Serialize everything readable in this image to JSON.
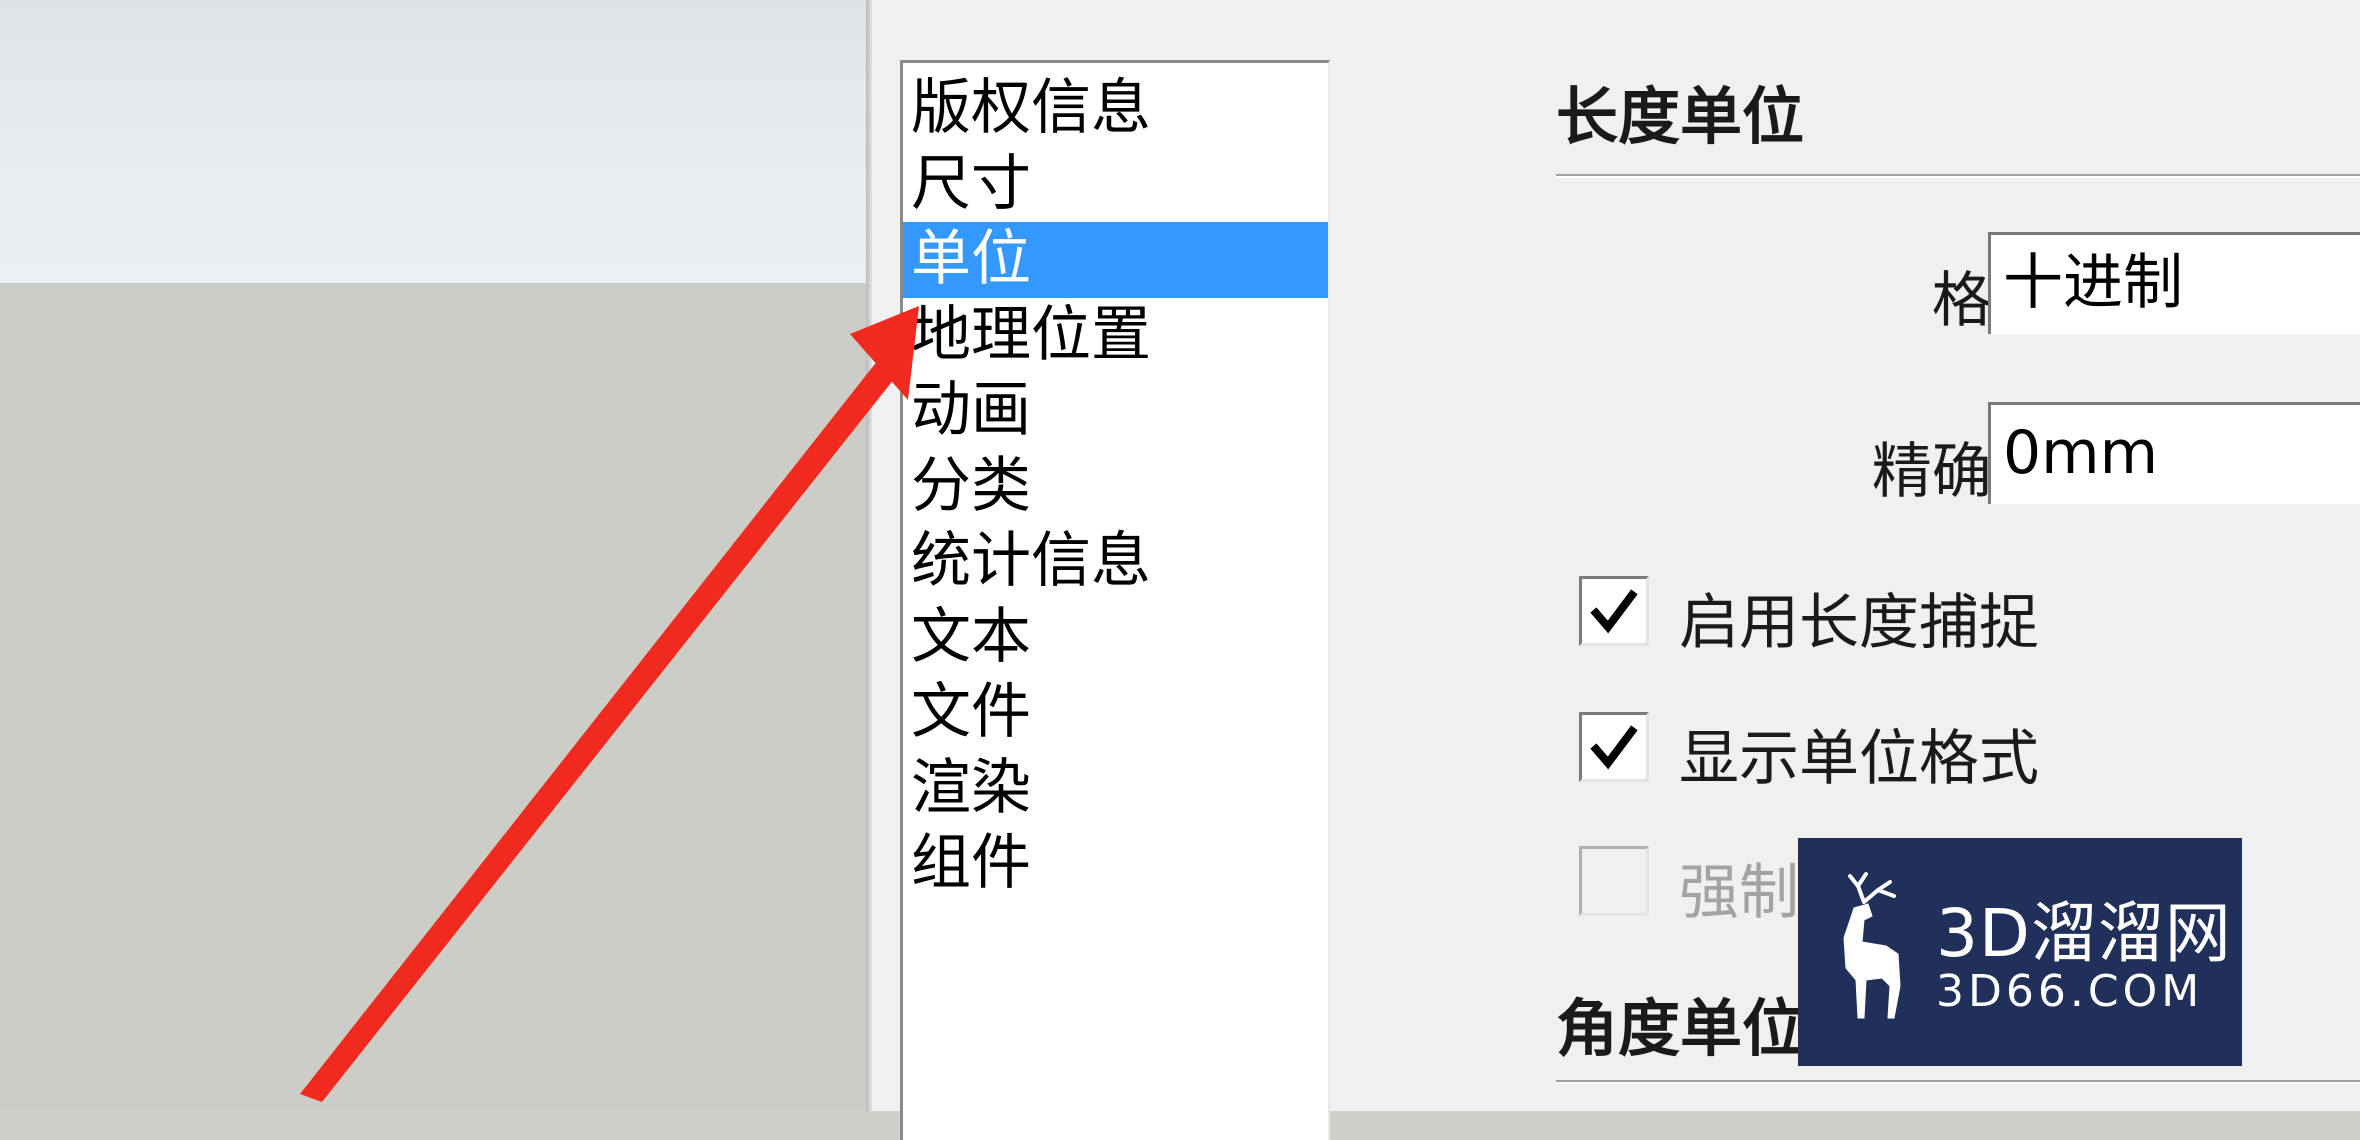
{
  "sidebar": {
    "items": [
      {
        "label": "版权信息",
        "selected": false
      },
      {
        "label": "尺寸",
        "selected": false
      },
      {
        "label": "单位",
        "selected": true
      },
      {
        "label": "地理位置",
        "selected": false
      },
      {
        "label": "动画",
        "selected": false
      },
      {
        "label": "分类",
        "selected": false
      },
      {
        "label": "统计信息",
        "selected": false
      },
      {
        "label": "文本",
        "selected": false
      },
      {
        "label": "文件",
        "selected": false
      },
      {
        "label": "渲染",
        "selected": false
      },
      {
        "label": "组件",
        "selected": false
      }
    ]
  },
  "length_units": {
    "title": "长度单位",
    "format_label": "格式:",
    "format_value": "十进制",
    "precision_label": "精确度:",
    "precision_value": "0mm",
    "enable_snap_label": "启用长度捕捉",
    "enable_snap_checked": true,
    "show_unit_format_label": "显示单位格式",
    "show_unit_format_checked": true,
    "force_label": "强制",
    "force_checked": false,
    "force_enabled": false
  },
  "angle_units": {
    "title": "角度单位"
  },
  "watermark": {
    "title": "3D溜溜网",
    "subtitle": "3D66.COM"
  },
  "colors": {
    "selection": "#3399ff",
    "arrow": "#f02a1e",
    "watermark_bg": "#20305a",
    "dialog_bg": "#f0f0f0"
  },
  "icons": {
    "arrow": "red-arrow-icon",
    "check": "checkmark-icon",
    "logo": "deer-logo-icon"
  }
}
